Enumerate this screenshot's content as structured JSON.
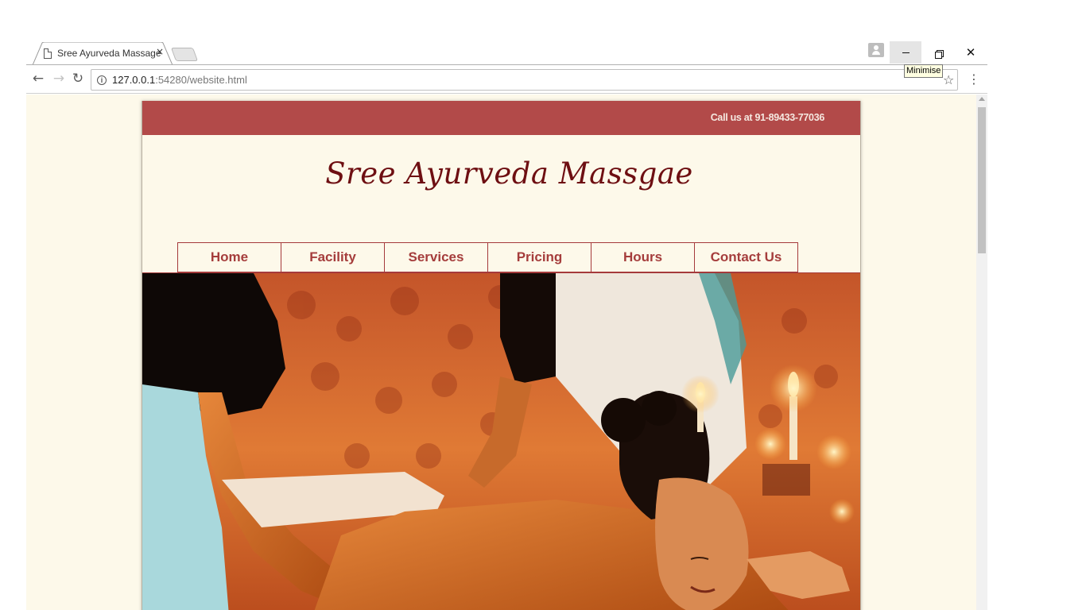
{
  "browser": {
    "tab_title": "Sree Ayurveda Massage",
    "tab_close": "×",
    "url_host": "127.0.0.1",
    "url_path": ":54280/website.html",
    "tooltip": "Minimise",
    "close_glyph": "✕"
  },
  "site": {
    "callus": "Call us at 91-89433-77036",
    "title": "Sree Ayurveda Massgae",
    "nav": [
      "Home",
      "Facility",
      "Services",
      "Pricing",
      "Hours",
      "Contact Us"
    ],
    "hero_alt": "massage-photo"
  },
  "colors": {
    "topbar": "#b24a49",
    "title": "#6e0f12",
    "nav_text": "#a53d3c",
    "page_bg": "#fdf9ea"
  },
  "icons": [
    "page-icon",
    "back-icon",
    "forward-icon",
    "reload-icon",
    "info-icon",
    "star-icon",
    "menu-icon",
    "profile-icon",
    "minimize-icon",
    "maximize-icon",
    "close-icon"
  ]
}
